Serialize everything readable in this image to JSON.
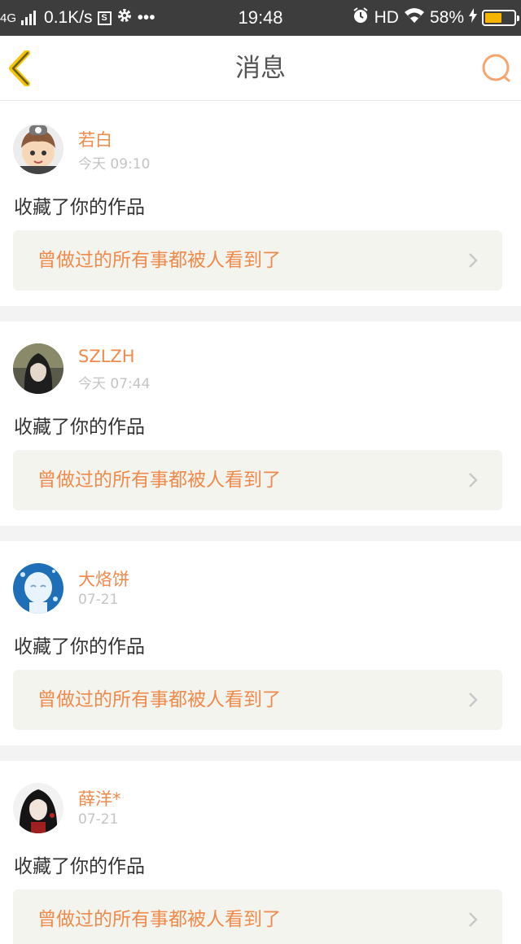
{
  "status_bar": {
    "network": "4G",
    "speed": "0.1K/s",
    "s_icon_label": "S",
    "more": "•••",
    "time": "19:48",
    "hd": "HD",
    "battery_percent": "58%",
    "battery_level": 0.58
  },
  "header": {
    "title": "消息",
    "icons": {
      "back": "back-chevron-icon",
      "search": "search-icon"
    },
    "accent_color": "#f08a4b"
  },
  "feed": [
    {
      "username": "若白",
      "time": "今天 09:10",
      "action": "收藏了你的作品",
      "work_title": "曾做过的所有事都被人看到了"
    },
    {
      "username": "SZLZH",
      "time": "今天 07:44",
      "action": "收藏了你的作品",
      "work_title": "曾做过的所有事都被人看到了"
    },
    {
      "username": "大烙饼",
      "time": "07-21",
      "action": "收藏了你的作品",
      "work_title": "曾做过的所有事都被人看到了"
    },
    {
      "username": "薛洋*",
      "time": "07-21",
      "action": "收藏了你的作品",
      "work_title": "曾做过的所有事都被人看到了"
    }
  ]
}
